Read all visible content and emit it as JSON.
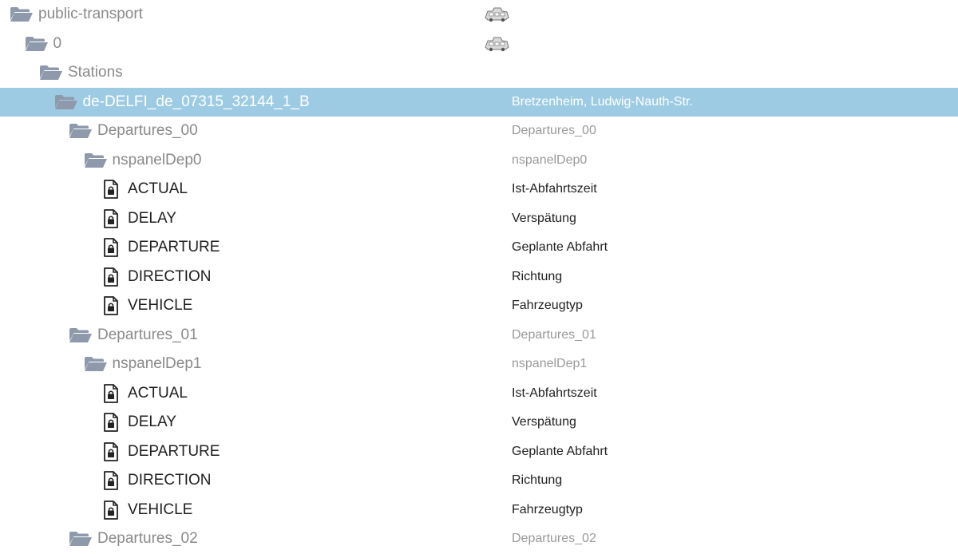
{
  "tree": {
    "rows": [
      {
        "kind": "folder",
        "level": 0,
        "name": "public-transport",
        "desc": "",
        "thumb": true
      },
      {
        "kind": "folder",
        "level": 1,
        "name": "0",
        "desc": "",
        "thumb": true
      },
      {
        "kind": "folder",
        "level": 2,
        "name": "Stations",
        "desc": ""
      },
      {
        "kind": "folder",
        "level": 3,
        "name": "de-DELFI_de_07315_32144_1_B",
        "desc": "Bretzenheim, Ludwig-Nauth-Str.",
        "selected": true
      },
      {
        "kind": "folder",
        "level": 4,
        "name": "Departures_00",
        "desc": "Departures_00"
      },
      {
        "kind": "folder",
        "level": 5,
        "name": "nspanelDep0",
        "desc": "nspanelDep0"
      },
      {
        "kind": "state",
        "level": 6,
        "name": "ACTUAL",
        "desc": "Ist-Abfahrtszeit"
      },
      {
        "kind": "state",
        "level": 6,
        "name": "DELAY",
        "desc": "Verspätung"
      },
      {
        "kind": "state",
        "level": 6,
        "name": "DEPARTURE",
        "desc": "Geplante Abfahrt"
      },
      {
        "kind": "state",
        "level": 6,
        "name": "DIRECTION",
        "desc": "Richtung"
      },
      {
        "kind": "state",
        "level": 6,
        "name": "VEHICLE",
        "desc": "Fahrzeugtyp"
      },
      {
        "kind": "folder",
        "level": 4,
        "name": "Departures_01",
        "desc": "Departures_01"
      },
      {
        "kind": "folder",
        "level": 5,
        "name": "nspanelDep1",
        "desc": "nspanelDep1"
      },
      {
        "kind": "state",
        "level": 6,
        "name": "ACTUAL",
        "desc": "Ist-Abfahrtszeit"
      },
      {
        "kind": "state",
        "level": 6,
        "name": "DELAY",
        "desc": "Verspätung"
      },
      {
        "kind": "state",
        "level": 6,
        "name": "DEPARTURE",
        "desc": "Geplante Abfahrt"
      },
      {
        "kind": "state",
        "level": 6,
        "name": "DIRECTION",
        "desc": "Richtung"
      },
      {
        "kind": "state",
        "level": 6,
        "name": "VEHICLE",
        "desc": "Fahrzeugtyp"
      },
      {
        "kind": "folder",
        "level": 4,
        "name": "Departures_02",
        "desc": "Departures_02"
      }
    ]
  },
  "colors": {
    "folder_icon": "#8e9aab",
    "selected_row": "#9dcbe3",
    "state_icon": "#222222"
  },
  "icons": {
    "folder": "folder-open-icon",
    "state": "locked-file-icon",
    "thumb": "vehicle-thumbnail-icon"
  }
}
